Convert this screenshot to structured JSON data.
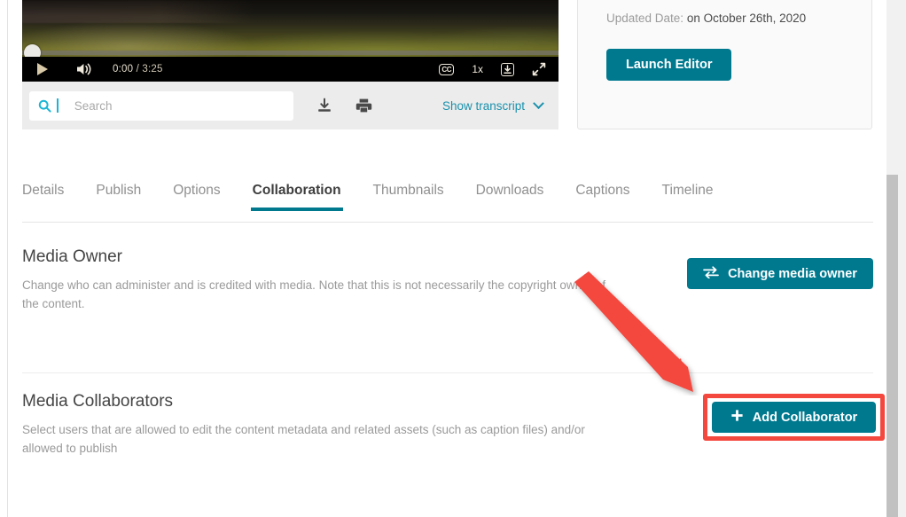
{
  "player": {
    "play_label": "Play",
    "volume_label": "Volume",
    "current_time": "0:00",
    "total_time": "/ 3:25",
    "cc_label": "CC",
    "speed_label": "1x",
    "download_label": "Download",
    "fullscreen_label": "Fullscreen"
  },
  "transcript": {
    "search_placeholder": "Search",
    "search_value": "",
    "download_label": "Download transcript",
    "print_label": "Print transcript",
    "show_transcript_label": "Show transcript"
  },
  "info_card": {
    "updated_label": "Updated Date:",
    "updated_value": "on October 26th, 2020",
    "launch_editor_label": "Launch Editor"
  },
  "tabs": [
    {
      "label": "Details",
      "active": false
    },
    {
      "label": "Publish",
      "active": false
    },
    {
      "label": "Options",
      "active": false
    },
    {
      "label": "Collaboration",
      "active": true
    },
    {
      "label": "Thumbnails",
      "active": false
    },
    {
      "label": "Downloads",
      "active": false
    },
    {
      "label": "Captions",
      "active": false
    },
    {
      "label": "Timeline",
      "active": false
    }
  ],
  "media_owner": {
    "title": "Media Owner",
    "description": "Change who can administer and is credited with media. Note that this is not necessarily the copyright owner of the content.",
    "button_label": "Change media owner",
    "button_icon": "swap-arrows-icon"
  },
  "media_collaborators": {
    "title": "Media Collaborators",
    "description": "Select users that are allowed to edit the content metadata and related assets (such as caption files) and/or allowed to publish",
    "button_label": "Add Collaborator",
    "button_icon": "plus-icon"
  },
  "annotations": {
    "arrow_color": "#f4473e",
    "highlight_color": "#f4473e"
  },
  "colors": {
    "teal": "#00798f",
    "link": "#1991ac",
    "accent_cyan": "#19b5d5",
    "muted_text": "#9a9a9a"
  }
}
